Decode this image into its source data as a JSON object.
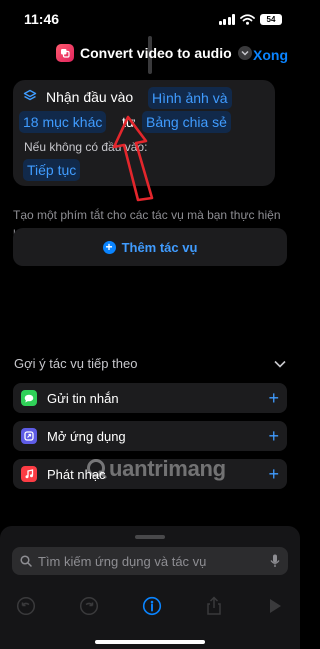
{
  "status_bar": {
    "time": "11:46",
    "battery": "54"
  },
  "nav": {
    "title": "Convert video to audio",
    "done_label": "Xong"
  },
  "input_card": {
    "label": "Nhận đầu vào",
    "token_types": "Hình ảnh và",
    "token_count": "18 mục khác",
    "from_word": "từ",
    "token_source": "Bảng chia sẻ",
    "fallback_label": "Nếu không có đầu vào:",
    "token_fallback": "Tiếp tục"
  },
  "description": "Tạo một phím tắt cho các tác vụ mà bạn thực hiện hàng ngày trong các ứng dụng.",
  "add_action_label": "Thêm tác vụ",
  "suggestions": {
    "header": "Gợi ý tác vụ tiếp theo",
    "items": [
      {
        "label": "Gửi tin nhắn",
        "icon": "messages-icon",
        "color": "#30d158"
      },
      {
        "label": "Mở ứng dụng",
        "icon": "open-app-icon",
        "color": "#5e5ce6"
      },
      {
        "label": "Phát nhạc",
        "icon": "music-icon",
        "color": "#fc3c44"
      }
    ]
  },
  "watermark": {
    "brand": "uantrimang"
  },
  "bottom_sheet": {
    "search_placeholder": "Tìm kiếm ứng dụng và tác vụ"
  },
  "colors": {
    "accent": "#0a84ff",
    "token_bg": "#11294a",
    "annotation_arrow": "#e3262c"
  }
}
